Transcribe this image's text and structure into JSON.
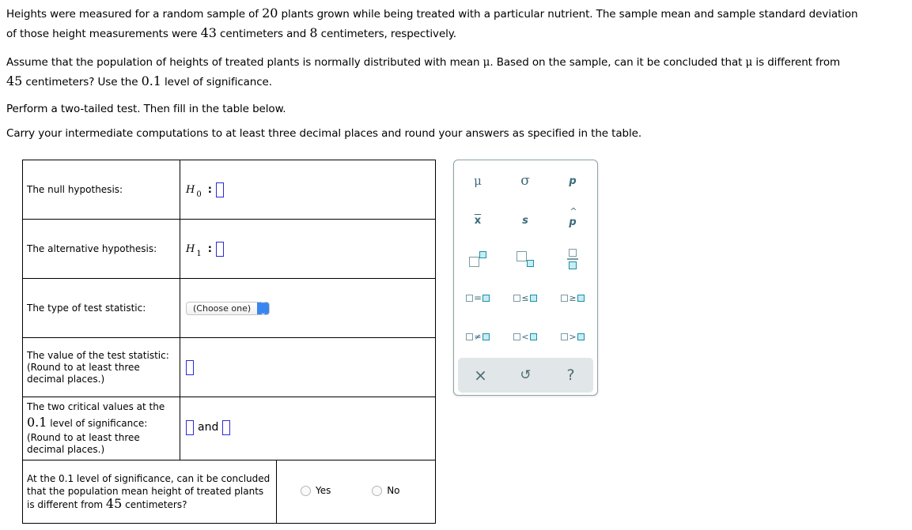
{
  "problem": {
    "p1_a": "Heights were measured for a random sample of ",
    "n": "20",
    "p1_b": " plants grown while being treated with a particular nutrient. The sample mean and sample standard deviation",
    "p1_c": "of those height measurements were ",
    "mean": "43",
    "p1_d": " centimeters and ",
    "sd": "8",
    "p1_e": " centimeters, respectively.",
    "p2_a": "Assume that the population of heights of treated plants is normally distributed with mean ",
    "mu": "μ",
    "p2_b": ". Based on the sample, can it be concluded that ",
    "p2_c": " is different from",
    "mu0": "45",
    "p2_d": " centimeters? Use the ",
    "alpha": "0.1",
    "p2_e": " level of significance.",
    "p3": "Perform a two-tailed test. Then fill in the table below.",
    "p4": "Carry your intermediate computations to at least three decimal places and round your answers as specified in the table."
  },
  "table": {
    "null_label": "The null hypothesis:",
    "null_H": "H",
    "null_sub": "0",
    "null_colon": ":",
    "alt_label": "The alternative hypothesis:",
    "alt_H": "H",
    "alt_sub": "1",
    "alt_colon": ":",
    "type_label": "The type of test statistic:",
    "type_select": "(Choose one)",
    "value_label_1": "The value of the test statistic:",
    "value_label_2": "(Round to at least three",
    "value_label_3": "decimal places.)",
    "crit_label_1": "The two critical values at the",
    "crit_alpha": "0.1",
    "crit_label_2": " level of significance:",
    "crit_label_3": "(Round to at least three",
    "crit_label_4": "decimal places.)",
    "crit_and": "and",
    "concl_label_1": "At the 0.1 level of significance, can it be concluded",
    "concl_label_2": "that the population mean height of treated plants",
    "concl_label_3": "is different from ",
    "concl_mu0": "45",
    "concl_label_4": " centimeters?",
    "yes": "Yes",
    "no": "No"
  },
  "palette": {
    "mu": "μ",
    "sigma": "σ",
    "p": "p",
    "xbar": "x",
    "s": "s",
    "phat": "p",
    "eq": "=",
    "le": "≤",
    "ge": "≥",
    "ne": "≠",
    "lt": "<",
    "gt": ">",
    "clear": "×",
    "undo": "↺",
    "help": "?"
  }
}
